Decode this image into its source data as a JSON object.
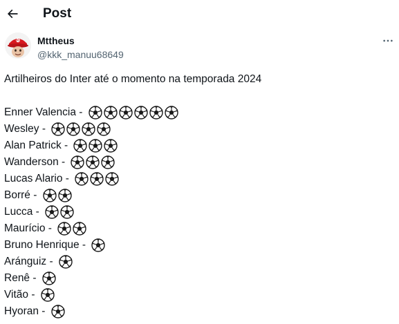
{
  "header": {
    "back_icon": "arrow-left-icon",
    "title": "Post"
  },
  "author": {
    "avatar_icon": "sport-club-internacional-crest-avatar",
    "display_name": "Mttheus",
    "handle": "@kkk_manuu68649",
    "more_icon": "more-horizontal-icon"
  },
  "post": {
    "intro": "Artilheiros do Inter até o momento na temporada 2024",
    "ball_icon": "soccer-ball-icon",
    "scorers": [
      {
        "label": "Enner Valencia - ",
        "goals": 6
      },
      {
        "label": "Wesley - ",
        "goals": 4
      },
      {
        "label": "Alan Patrick - ",
        "goals": 3
      },
      {
        "label": "Wanderson - ",
        "goals": 3
      },
      {
        "label": "Lucas Alario - ",
        "goals": 3
      },
      {
        "label": "Borré - ",
        "goals": 2
      },
      {
        "label": "Lucca - ",
        "goals": 2
      },
      {
        "label": "Maurício - ",
        "goals": 2
      },
      {
        "label": "Bruno Henrique - ",
        "goals": 1
      },
      {
        "label": "Aránguiz - ",
        "goals": 1
      },
      {
        "label": "Renê - ",
        "goals": 1
      },
      {
        "label": "Vitão - ",
        "goals": 1
      },
      {
        "label": "Hyoran - ",
        "goals": 1
      }
    ]
  },
  "colors": {
    "text": "#0f1419",
    "secondary_text": "#536471",
    "avatar_red": "#d71920"
  }
}
